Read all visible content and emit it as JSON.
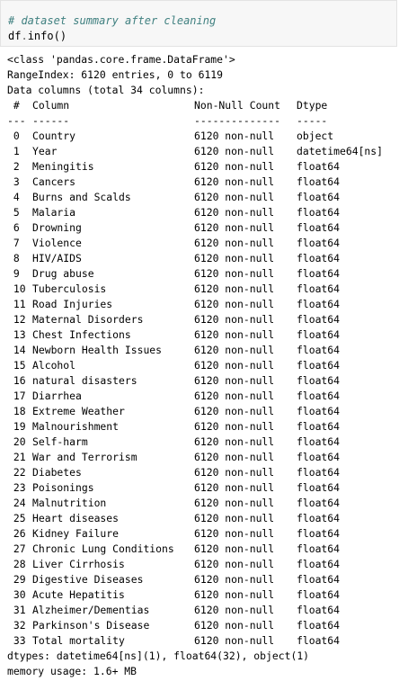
{
  "input": {
    "comment": "# dataset summary after cleaning",
    "code_obj": "df",
    "code_dot": ".",
    "code_fn": "info",
    "code_paren": "()"
  },
  "output": {
    "class_line": "<class 'pandas.core.frame.DataFrame'>",
    "range_line": "RangeIndex: 6120 entries, 0 to 6119",
    "columns_line": "Data columns (total 34 columns):",
    "header": {
      "idx": " #",
      "name": "Column",
      "count": "Non-Null Count",
      "dtype": "Dtype"
    },
    "separator": {
      "idx": "---",
      "name": "------",
      "count": "--------------",
      "dtype": "-----"
    },
    "rows": [
      {
        "idx": " 0",
        "name": "Country",
        "count": "6120 non-null",
        "dtype": "object"
      },
      {
        "idx": " 1",
        "name": "Year",
        "count": "6120 non-null",
        "dtype": "datetime64[ns]"
      },
      {
        "idx": " 2",
        "name": "Meningitis",
        "count": "6120 non-null",
        "dtype": "float64"
      },
      {
        "idx": " 3",
        "name": "Cancers",
        "count": "6120 non-null",
        "dtype": "float64"
      },
      {
        "idx": " 4",
        "name": "Burns and Scalds",
        "count": "6120 non-null",
        "dtype": "float64"
      },
      {
        "idx": " 5",
        "name": "Malaria",
        "count": "6120 non-null",
        "dtype": "float64"
      },
      {
        "idx": " 6",
        "name": "Drowning",
        "count": "6120 non-null",
        "dtype": "float64"
      },
      {
        "idx": " 7",
        "name": "Violence",
        "count": "6120 non-null",
        "dtype": "float64"
      },
      {
        "idx": " 8",
        "name": "HIV/AIDS",
        "count": "6120 non-null",
        "dtype": "float64"
      },
      {
        "idx": " 9",
        "name": "Drug abuse",
        "count": "6120 non-null",
        "dtype": "float64"
      },
      {
        "idx": " 10",
        "name": "Tuberculosis",
        "count": "6120 non-null",
        "dtype": "float64"
      },
      {
        "idx": " 11",
        "name": "Road Injuries",
        "count": "6120 non-null",
        "dtype": "float64"
      },
      {
        "idx": " 12",
        "name": "Maternal Disorders",
        "count": "6120 non-null",
        "dtype": "float64"
      },
      {
        "idx": " 13",
        "name": "Chest Infections",
        "count": "6120 non-null",
        "dtype": "float64"
      },
      {
        "idx": " 14",
        "name": "Newborn Health Issues",
        "count": "6120 non-null",
        "dtype": "float64"
      },
      {
        "idx": " 15",
        "name": "Alcohol",
        "count": "6120 non-null",
        "dtype": "float64"
      },
      {
        "idx": " 16",
        "name": "natural disasters",
        "count": "6120 non-null",
        "dtype": "float64"
      },
      {
        "idx": " 17",
        "name": "Diarrhea",
        "count": "6120 non-null",
        "dtype": "float64"
      },
      {
        "idx": " 18",
        "name": "Extreme Weather",
        "count": "6120 non-null",
        "dtype": "float64"
      },
      {
        "idx": " 19",
        "name": "Malnourishment",
        "count": "6120 non-null",
        "dtype": "float64"
      },
      {
        "idx": " 20",
        "name": "Self-harm",
        "count": "6120 non-null",
        "dtype": "float64"
      },
      {
        "idx": " 21",
        "name": "War and Terrorism",
        "count": "6120 non-null",
        "dtype": "float64"
      },
      {
        "idx": " 22",
        "name": "Diabetes",
        "count": "6120 non-null",
        "dtype": "float64"
      },
      {
        "idx": " 23",
        "name": "Poisonings",
        "count": "6120 non-null",
        "dtype": "float64"
      },
      {
        "idx": " 24",
        "name": "Malnutrition",
        "count": "6120 non-null",
        "dtype": "float64"
      },
      {
        "idx": " 25",
        "name": "Heart diseases",
        "count": "6120 non-null",
        "dtype": "float64"
      },
      {
        "idx": " 26",
        "name": "Kidney Failure",
        "count": "6120 non-null",
        "dtype": "float64"
      },
      {
        "idx": " 27",
        "name": "Chronic Lung Conditions",
        "count": "6120 non-null",
        "dtype": "float64"
      },
      {
        "idx": " 28",
        "name": "Liver Cirrhosis",
        "count": "6120 non-null",
        "dtype": "float64"
      },
      {
        "idx": " 29",
        "name": "Digestive Diseases",
        "count": "6120 non-null",
        "dtype": "float64"
      },
      {
        "idx": " 30",
        "name": "Acute Hepatitis",
        "count": "6120 non-null",
        "dtype": "float64"
      },
      {
        "idx": " 31",
        "name": "Alzheimer/Dementias",
        "count": "6120 non-null",
        "dtype": "float64"
      },
      {
        "idx": " 32",
        "name": "Parkinson's Disease",
        "count": "6120 non-null",
        "dtype": "float64"
      },
      {
        "idx": " 33",
        "name": "Total mortality",
        "count": "6120 non-null",
        "dtype": "float64"
      }
    ],
    "dtypes_line": "dtypes: datetime64[ns](1), float64(32), object(1)",
    "memory_line": "memory usage: 1.6+ MB"
  }
}
